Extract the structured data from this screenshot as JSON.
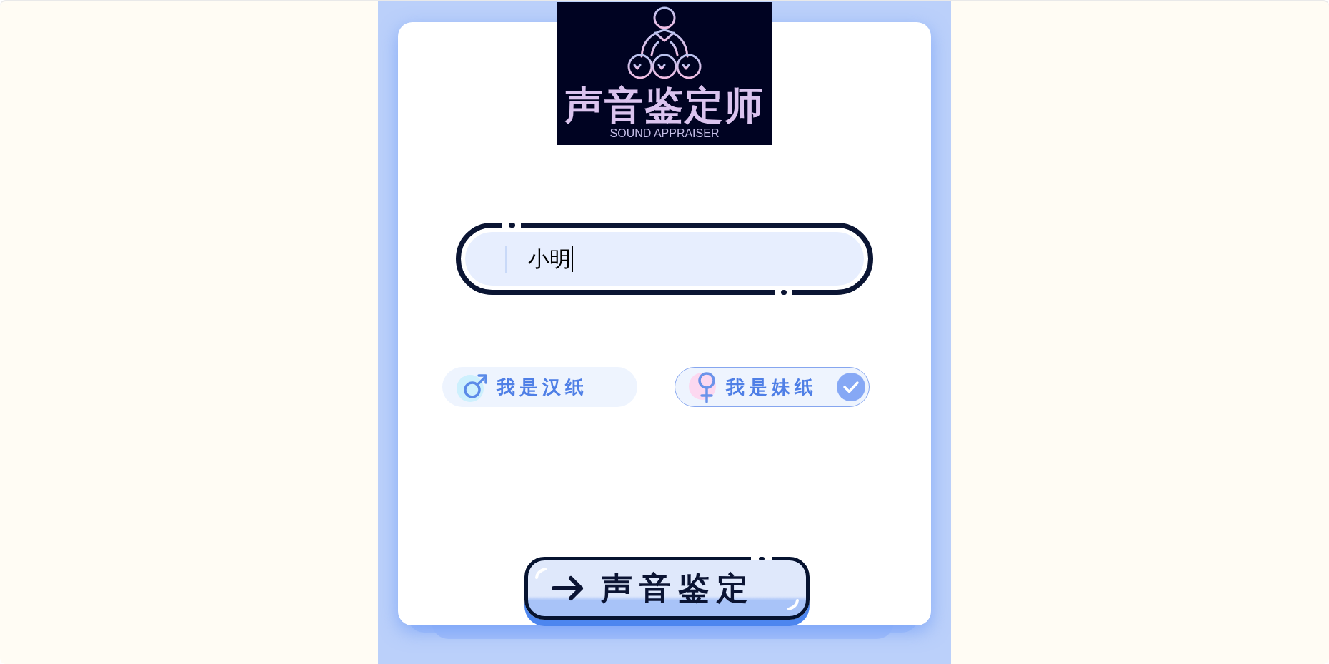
{
  "logo": {
    "title": "声音鉴定师",
    "subtitle": "SOUND APPRAISER"
  },
  "name_field": {
    "value": "小明"
  },
  "gender_options": [
    {
      "label": "我是汉纸",
      "kind": "male",
      "selected": false
    },
    {
      "label": "我是妹纸",
      "kind": "female",
      "selected": true
    }
  ],
  "submit_button": {
    "label": "声音鉴定"
  }
}
